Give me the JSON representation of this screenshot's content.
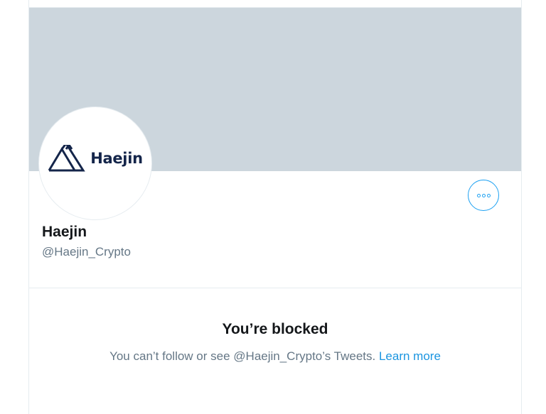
{
  "profile": {
    "display_name": "Haejin",
    "handle": "@Haejin_Crypto",
    "avatar_logo_text": "Haejin",
    "avatar_logo_icon": "mountain-logo-icon"
  },
  "actions": {
    "more_icon": "more-horizontal-icon"
  },
  "blocked": {
    "title": "You’re blocked",
    "message": "You can’t follow or see @Haejin_Crypto’s Tweets.",
    "learn_more": "Learn more"
  },
  "colors": {
    "banner": "#ccd6dd",
    "accent": "#1da1f2",
    "link": "#1b95e0",
    "logo": "#14254a",
    "secondary_text": "#657786"
  }
}
